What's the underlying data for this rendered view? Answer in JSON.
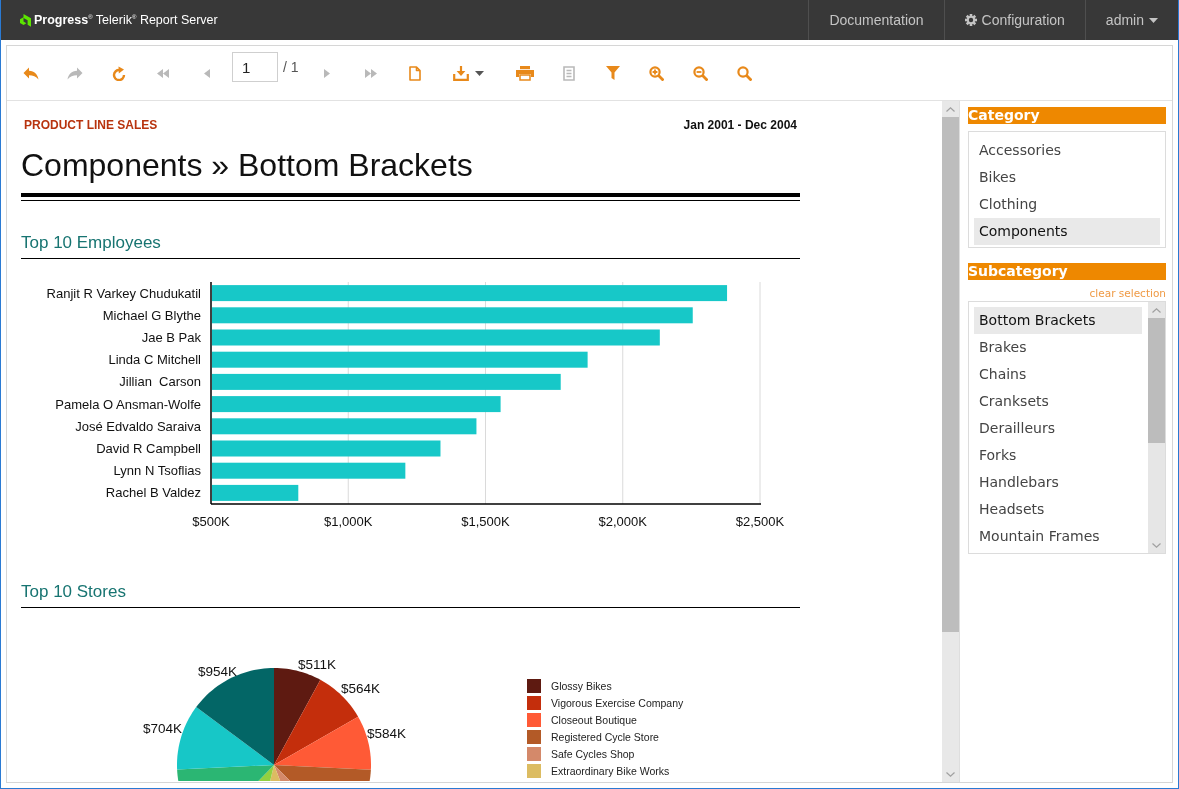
{
  "header": {
    "brand": "**Progress**$^{®}$ Telerik$^{®}$ Report Server",
    "nav": [
      {
        "kind": "link",
        "label": "Documentation"
      },
      {
        "kind": "settings",
        "label": "Configuration"
      },
      {
        "kind": "menu",
        "label": "admin"
      }
    ]
  },
  "toolbar": [
    {
      "kind": "back",
      "disabled": false
    },
    {
      "kind": "forward",
      "disabled": true
    },
    {
      "kind": "refresh",
      "disabled": false
    },
    {
      "kind": "first",
      "disabled": true
    },
    {
      "kind": "previous",
      "disabled": true
    },
    {
      "kind": "page",
      "value": "1",
      "total": "/ 1",
      "disabled": false
    },
    {
      "kind": "next",
      "disabled": true
    },
    {
      "kind": "last",
      "disabled": true
    },
    {
      "kind": "document",
      "disabled": false
    },
    {
      "kind": "export",
      "disabled": false
    },
    {
      "kind": "print",
      "disabled": false
    },
    {
      "kind": "copy",
      "disabled": true
    },
    {
      "kind": "filter",
      "disabled": false
    },
    {
      "kind": "zoom_in",
      "disabled": false
    },
    {
      "kind": "zoom_out",
      "disabled": false
    },
    {
      "kind": "zoom",
      "disabled": false
    }
  ],
  "report": {
    "label": "PRODUCT LINE SALES",
    "period": "Jan 2001 - Dec 2004",
    "title": "Components » Bottom Brackets",
    "sections": [
      {
        "kind": "chart",
        "title": "Top 10 Employees",
        "chart_data": {
          "type": "bar",
          "orientation": "horizontal",
          "grid": true,
          "categories": [
            "Ranjit R Varkey Chudukatil",
            "Michael G Blythe",
            "Jae B Pak",
            "Linda C Mitchell",
            "Jillian  Carson",
            "Pamela O Ansman-Wolfe",
            "José Edvaldo Saraiva",
            "David R Campbell",
            "Lynn N Tsoflias",
            "Rachel B Valdez"
          ],
          "series": [
            {
              "color": "#17c8c8",
              "values": [
                2380,
                2255,
                2135,
                1872,
                1774,
                1555,
                1467,
                1336,
                1208,
                818
              ]
            }
          ],
          "xlim": [
            500,
            2500
          ],
          "xticks": [
            {
              "value": 500,
              "label": "$500K"
            },
            {
              "value": 1000,
              "label": "$1,000K"
            },
            {
              "value": 1500,
              "label": "$1,500K"
            },
            {
              "value": 2000,
              "label": "$2,000K"
            },
            {
              "value": 2500,
              "label": "$2,500K"
            }
          ]
        }
      },
      {
        "kind": "pie_picture",
        "title": "Top 10 Stores",
        "value_labels": [
          "$511K",
          "$564K",
          "$584K",
          "$704K",
          "$954K"
        ],
        "legend": [
          {
            "label": "Glossy Bikes",
            "color": "#5e1a11"
          },
          {
            "label": "Vigorous Exercise Company",
            "color": "#c42e0c"
          },
          {
            "label": "Closeout Boutique",
            "color": "#ff5a36"
          },
          {
            "label": "Registered Cycle Store",
            "color": "#b35a27"
          },
          {
            "label": "Safe Cycles Shop",
            "color": "#d4896a"
          },
          {
            "label": "Extraordinary Bike Works",
            "color": "#dcbc62"
          }
        ]
      }
    ]
  },
  "filters": [
    {
      "kind": "list",
      "title": "Category",
      "items": [
        {
          "label": "Accessories",
          "selected": false
        },
        {
          "label": "Bikes",
          "selected": false
        },
        {
          "label": "Clothing",
          "selected": false
        },
        {
          "label": "Components",
          "selected": true
        }
      ]
    },
    {
      "kind": "scrolling_list",
      "title": "Subcategory",
      "action": "clear selection",
      "items": [
        {
          "label": "Bottom Brackets",
          "selected": true
        },
        {
          "label": "Brakes",
          "selected": false
        },
        {
          "label": "Chains",
          "selected": false
        },
        {
          "label": "Cranksets",
          "selected": false
        },
        {
          "label": "Derailleurs",
          "selected": false
        },
        {
          "label": "Forks",
          "selected": false
        },
        {
          "label": "Handlebars",
          "selected": false
        },
        {
          "label": "Headsets",
          "selected": false
        },
        {
          "label": "Mountain Frames",
          "selected": false
        }
      ]
    }
  ]
}
